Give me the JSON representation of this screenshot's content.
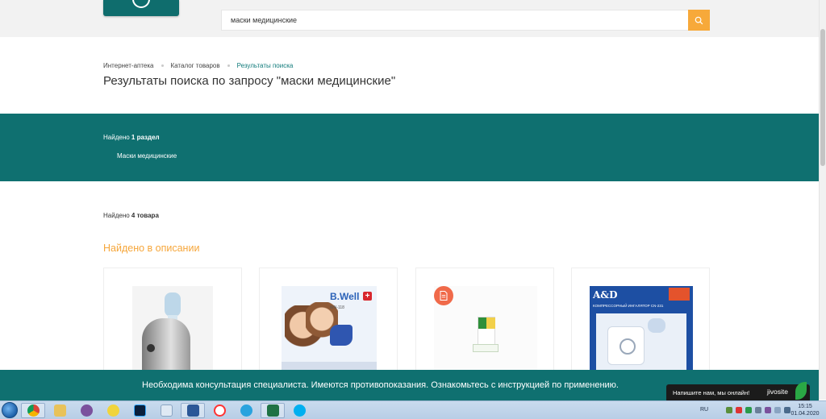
{
  "search": {
    "value": "маски медицинские"
  },
  "breadcrumbs": [
    "Интернет-аптека",
    "Каталог товаров",
    "Результаты поиска"
  ],
  "page_title": "Результаты поиска по запросу \"маски медицинские\"",
  "sections": {
    "found_prefix": "Найдено",
    "found_count": "1 раздел",
    "items": [
      "Маски медицинские"
    ]
  },
  "goods": {
    "found_prefix": "Найдено",
    "found_count": "4 товара",
    "heading": "Найдено в описании"
  },
  "products": [
    {
      "image": "nebulizer"
    },
    {
      "image": "bwell-box",
      "brand": "B.Well",
      "model": "WN-118"
    },
    {
      "image": "pills-pack"
    },
    {
      "image": "and-inhaler-box",
      "brand": "A&D",
      "model_text": "КОМПРЕССОРНЫЙ ИНГАЛЯТОР CN-231"
    }
  ],
  "consult_banner": "Необходима консультация специалиста. Имеются противопоказания. Ознакомьтесь с инструкцией по применению.",
  "chat_widget": {
    "message": "Напишите нам, мы онлайн!",
    "brand": "jivosite"
  },
  "taskbar": {
    "language": "RU",
    "time": "15:15",
    "date": "01.04.2020",
    "apps": [
      "chrome-icon",
      "file-explorer-icon",
      "viber-icon",
      "batman-icon",
      "photoshop-icon",
      "notepad-icon",
      "word-icon",
      "yandex-icon",
      "telegram-icon",
      "excel-icon",
      "skype-icon"
    ]
  },
  "colors": {
    "teal": "#0f7070",
    "accent_orange": "#f7a93a",
    "heading_orange": "#f6a63a",
    "badge_red": "#f06a4a"
  }
}
